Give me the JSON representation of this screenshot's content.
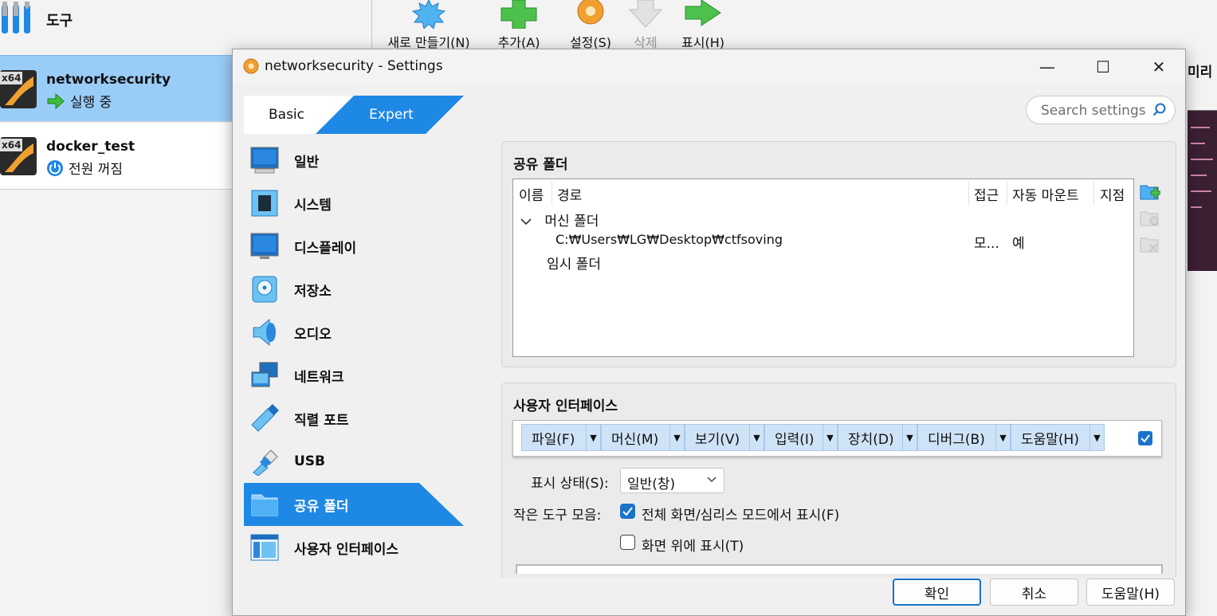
{
  "manager": {
    "tools_label": "도구",
    "vms": [
      {
        "name": "networksecurity",
        "state": "실행 중",
        "os_badge": "x64"
      },
      {
        "name": "docker_test",
        "state": "전원 꺼짐",
        "os_badge": "x64"
      }
    ],
    "toolbar": {
      "new": "새로 만들기(N)",
      "add": "추가(A)",
      "settings": "설정(S)",
      "delete": "삭제",
      "show": "표시(H)"
    },
    "right_partial_title": "미리 보"
  },
  "dialog": {
    "title": "networksecurity - Settings",
    "controls": {
      "minimize": "—",
      "maximize": "☐",
      "close": "✕"
    },
    "mode_tabs": {
      "basic": "Basic",
      "expert": "Expert",
      "active": "Expert"
    },
    "search_placeholder": "Search settings",
    "nav": [
      {
        "label": "일반",
        "icon": "monitor-icon"
      },
      {
        "label": "시스템",
        "icon": "chip-icon"
      },
      {
        "label": "디스플레이",
        "icon": "display-icon"
      },
      {
        "label": "저장소",
        "icon": "disk-icon"
      },
      {
        "label": "오디오",
        "icon": "speaker-icon"
      },
      {
        "label": "네트워크",
        "icon": "network-icon"
      },
      {
        "label": "직렬 포트",
        "icon": "serial-port-icon"
      },
      {
        "label": "USB",
        "icon": "usb-icon"
      },
      {
        "label": "공유 폴더",
        "icon": "shared-folder-icon"
      },
      {
        "label": "사용자 인터페이스",
        "icon": "user-interface-icon"
      }
    ],
    "active_nav": "공유 폴더",
    "shared_folders": {
      "section_title": "공유 폴더",
      "columns": [
        "이름",
        "경로",
        "접근",
        "자동 마운트",
        "지점"
      ],
      "groups": [
        {
          "name": "머신 폴더",
          "expanded": true,
          "rows": [
            {
              "path": "C:₩Users₩LG₩Desktop₩ctfsoving",
              "access": "모...",
              "automount": "예",
              "mount_point": ""
            }
          ]
        },
        {
          "name": "임시 폴더",
          "expanded": false,
          "rows": []
        }
      ]
    },
    "user_interface": {
      "section_title": "사용자 인터페이스",
      "menubar_items": [
        "파일(F)",
        "머신(M)",
        "보기(V)",
        "입력(I)",
        "장치(D)",
        "디버그(B)",
        "도움말(H)"
      ],
      "menubar_enabled": true,
      "visual_state_label": "표시 상태(S):",
      "visual_state_value": "일반(창)",
      "mini_toolbar_label": "작은 도구 모음:",
      "mini_toolbar_fullscreen": {
        "label": "전체 화면/심리스 모드에서 표시(F)",
        "checked": true
      },
      "mini_toolbar_top": {
        "label": "화면 위에 표시(T)",
        "checked": false
      }
    },
    "buttons": {
      "ok": "확인",
      "cancel": "취소",
      "help": "도움말(H)"
    }
  },
  "colors": {
    "accent": "#1e88e5",
    "selection": "#99cdf8",
    "menu_cell": "#cfe3f6"
  }
}
